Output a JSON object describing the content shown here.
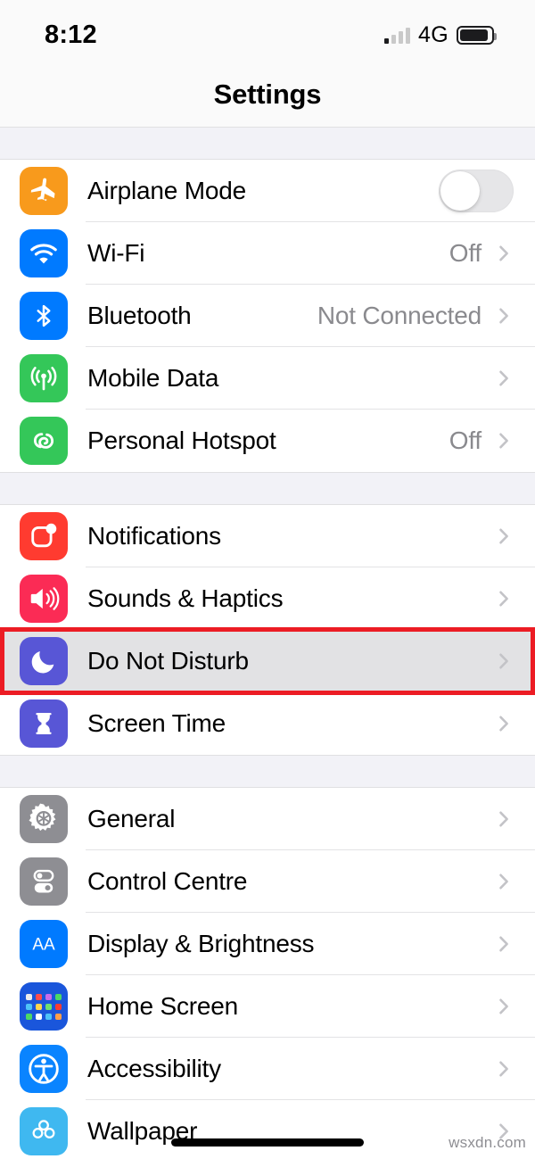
{
  "status_bar": {
    "time": "8:12",
    "network": "4G",
    "signal_bars_active": 1,
    "signal_bars_total": 4,
    "battery_level_pct": 92
  },
  "header": {
    "title": "Settings"
  },
  "groups": [
    {
      "rows": [
        {
          "label": "Airplane Mode",
          "value": "",
          "icon": "airplane-icon",
          "icon_color": "#F89A1C",
          "accessory": "toggle",
          "toggle_on": false,
          "highlight": false
        },
        {
          "label": "Wi-Fi",
          "value": "Off",
          "icon": "wifi-icon",
          "icon_color": "#007AFF",
          "accessory": "chevron",
          "highlight": false
        },
        {
          "label": "Bluetooth",
          "value": "Not Connected",
          "icon": "bluetooth-icon",
          "icon_color": "#007AFF",
          "accessory": "chevron",
          "highlight": false
        },
        {
          "label": "Mobile Data",
          "value": "",
          "icon": "cellular-antenna-icon",
          "icon_color": "#34C759",
          "accessory": "chevron",
          "highlight": false
        },
        {
          "label": "Personal Hotspot",
          "value": "Off",
          "icon": "hotspot-link-icon",
          "icon_color": "#34C759",
          "accessory": "chevron",
          "highlight": false
        }
      ]
    },
    {
      "rows": [
        {
          "label": "Notifications",
          "value": "",
          "icon": "notification-badge-icon",
          "icon_color": "#FF3B30",
          "accessory": "chevron",
          "highlight": false
        },
        {
          "label": "Sounds & Haptics",
          "value": "",
          "icon": "speaker-waves-icon",
          "icon_color": "#FB2B55",
          "accessory": "chevron",
          "highlight": false
        },
        {
          "label": "Do Not Disturb",
          "value": "",
          "icon": "crescent-moon-icon",
          "icon_color": "#5856D6",
          "accessory": "chevron",
          "highlight": true
        },
        {
          "label": "Screen Time",
          "value": "",
          "icon": "hourglass-icon",
          "icon_color": "#5856D6",
          "accessory": "chevron",
          "highlight": false
        }
      ]
    },
    {
      "rows": [
        {
          "label": "General",
          "value": "",
          "icon": "gear-icon",
          "icon_color": "#8E8E93",
          "accessory": "chevron",
          "highlight": false
        },
        {
          "label": "Control Centre",
          "value": "",
          "icon": "control-sliders-icon",
          "icon_color": "#8E8E93",
          "accessory": "chevron",
          "highlight": false
        },
        {
          "label": "Display & Brightness",
          "value": "",
          "icon": "text-size-aa-icon",
          "icon_color": "#007AFF",
          "accessory": "chevron",
          "highlight": false
        },
        {
          "label": "Home Screen",
          "value": "",
          "icon": "app-grid-icon",
          "icon_color": "#1A56DB",
          "accessory": "chevron",
          "highlight": false
        },
        {
          "label": "Accessibility",
          "value": "",
          "icon": "accessibility-person-icon",
          "icon_color": "#0A84FF",
          "accessory": "chevron",
          "highlight": false
        },
        {
          "label": "Wallpaper",
          "value": "",
          "icon": "wallpaper-flower-icon",
          "icon_color": "#3FB8F0",
          "accessory": "chevron",
          "highlight": false
        }
      ]
    }
  ],
  "annotation": {
    "target_label": "Do Not Disturb",
    "color": "#EC1C24"
  },
  "watermark": {
    "text": "wsxdn.com"
  }
}
